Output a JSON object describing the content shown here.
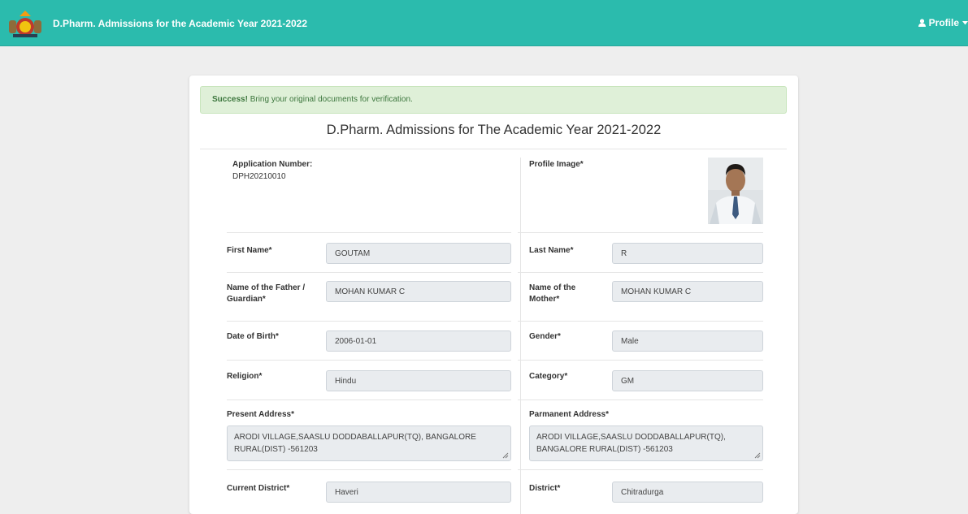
{
  "header": {
    "title": "D.Pharm. Admissions for the Academic Year 2021-2022",
    "profile_label": "Profile"
  },
  "alert": {
    "strong": "Success!",
    "message": " Bring your original documents for verification."
  },
  "form": {
    "heading": "D.Pharm. Admissions for The Academic Year 2021-2022",
    "application_number_label": "Application Number:",
    "application_number": "DPH20210010",
    "profile_image_label": "Profile Image*",
    "first_name_label": "First Name*",
    "first_name": "GOUTAM",
    "last_name_label": "Last Name*",
    "last_name": "R",
    "father_label": "Name of the Father / Guardian*",
    "father": "MOHAN KUMAR C",
    "mother_label": "Name of the Mother*",
    "mother": "MOHAN KUMAR C",
    "dob_label": "Date of Birth*",
    "dob": "2006-01-01",
    "gender_label": "Gender*",
    "gender": "Male",
    "religion_label": "Religion*",
    "religion": "Hindu",
    "category_label": "Category*",
    "category": "GM",
    "present_address_label": "Present Address*",
    "present_address": "ARODI VILLAGE,SAASLU DODDABALLAPUR(TQ), BANGALORE RURAL(DIST) -561203",
    "permanent_address_label": "Parmanent Address*",
    "permanent_address": "ARODI VILLAGE,SAASLU DODDABALLAPUR(TQ), BANGALORE RURAL(DIST) -561203",
    "current_district_label": "Current District*",
    "current_district": "Haveri",
    "district_label": "District*",
    "district": "Chitradurga"
  },
  "colors": {
    "navbar": "#2bbbad",
    "alert_bg": "#dff0d8",
    "alert_text": "#3c763d"
  }
}
